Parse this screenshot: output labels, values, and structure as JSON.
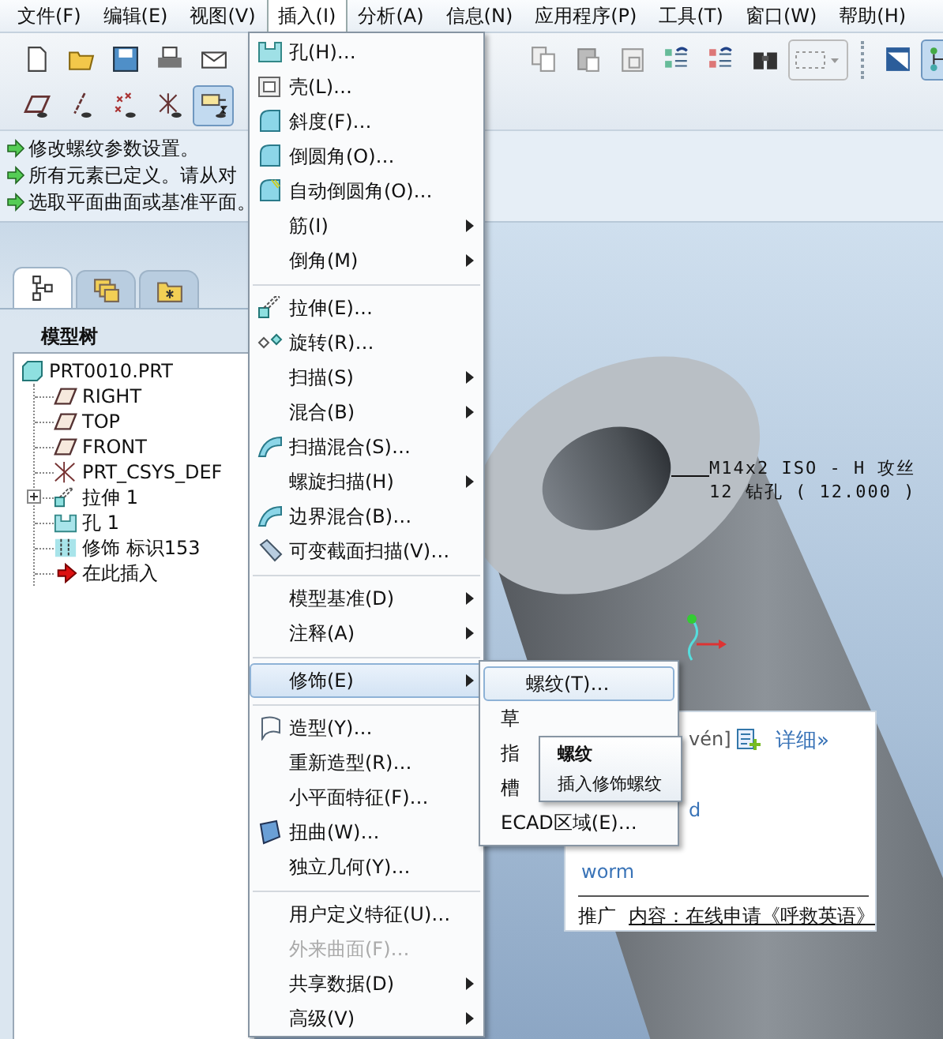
{
  "menubar": [
    {
      "label": "文件(F)",
      "selected": false
    },
    {
      "label": "编辑(E)",
      "selected": false
    },
    {
      "label": "视图(V)",
      "selected": false
    },
    {
      "label": "插入(I)",
      "selected": true
    },
    {
      "label": "分析(A)",
      "selected": false
    },
    {
      "label": "信息(N)",
      "selected": false
    },
    {
      "label": "应用程序(P)",
      "selected": false
    },
    {
      "label": "工具(T)",
      "selected": false
    },
    {
      "label": "窗口(W)",
      "selected": false
    },
    {
      "label": "帮助(H)",
      "selected": false
    }
  ],
  "toolbar": {
    "row_1_left": [
      {
        "kind": "new",
        "pressed": false
      },
      {
        "kind": "open",
        "pressed": false
      },
      {
        "kind": "save",
        "pressed": false
      },
      {
        "kind": "print",
        "pressed": false
      },
      {
        "kind": "mail",
        "pressed": false
      }
    ],
    "row_1_right": [
      {
        "kind": "copy",
        "pressed": false
      },
      {
        "kind": "paste",
        "pressed": false
      },
      {
        "kind": "paste_special",
        "pressed": false
      },
      {
        "kind": "regen",
        "pressed": false
      },
      {
        "kind": "regen_red",
        "pressed": false
      },
      {
        "kind": "find",
        "pressed": false
      },
      {
        "kind": "select_box",
        "pressed": false
      }
    ],
    "row_1_far_right": [
      {
        "kind": "view",
        "pressed": false
      },
      {
        "kind": "tree",
        "pressed": true
      }
    ],
    "row_2": [
      {
        "kind": "plane",
        "pressed": false
      },
      {
        "kind": "axis",
        "pressed": false
      },
      {
        "kind": "point",
        "pressed": false
      },
      {
        "kind": "csys",
        "pressed": false
      },
      {
        "kind": "annotation",
        "pressed": true
      }
    ]
  },
  "messages": [
    "修改螺纹参数设置。",
    "所有元素已定义。请从对",
    "选取平面曲面或基准平面。"
  ],
  "navigator_tabs": [
    {
      "kind": "tree",
      "selected": true
    },
    {
      "kind": "layers",
      "selected": false
    },
    {
      "kind": "folder",
      "selected": false
    }
  ],
  "model_tree": {
    "title": "模型树",
    "root": {
      "label": "PRT0010.PRT",
      "kind": "part",
      "children": [
        {
          "label": "RIGHT",
          "kind": "plane"
        },
        {
          "label": "TOP",
          "kind": "plane"
        },
        {
          "label": "FRONT",
          "kind": "plane"
        },
        {
          "label": "PRT_CSYS_DEF",
          "kind": "csys"
        },
        {
          "label": "拉伸 1",
          "kind": "extrude",
          "expanded": false
        },
        {
          "label": "孔 1",
          "kind": "hole"
        },
        {
          "label": "修饰 标识153",
          "kind": "cosmetic"
        },
        {
          "label": "在此插入",
          "kind": "insert_here"
        }
      ]
    }
  },
  "viewport": {
    "annotation": [
      "M14x2 ISO - H 攻丝",
      "12 钻孔 ( 12.000 )"
    ]
  },
  "insert_menu": {
    "items": [
      {
        "kind": "command",
        "label": "孔(H)…",
        "selected": false,
        "disabled": false
      },
      {
        "kind": "command",
        "label": "壳(L)…",
        "selected": false,
        "disabled": false
      },
      {
        "kind": "command",
        "label": "斜度(F)…",
        "selected": false,
        "disabled": false
      },
      {
        "kind": "command",
        "label": "倒圆角(O)…",
        "selected": false,
        "disabled": false
      },
      {
        "kind": "command",
        "label": "自动倒圆角(O)…",
        "selected": false,
        "disabled": false
      },
      {
        "kind": "submenu",
        "label": "筋(I)",
        "selected": false,
        "disabled": false
      },
      {
        "kind": "submenu",
        "label": "倒角(M)",
        "selected": false,
        "disabled": false
      },
      {
        "kind": "separator"
      },
      {
        "kind": "command",
        "label": "拉伸(E)…",
        "selected": false,
        "disabled": false
      },
      {
        "kind": "command",
        "label": "旋转(R)…",
        "selected": false,
        "disabled": false
      },
      {
        "kind": "submenu",
        "label": "扫描(S)",
        "selected": false,
        "disabled": false
      },
      {
        "kind": "submenu",
        "label": "混合(B)",
        "selected": false,
        "disabled": false
      },
      {
        "kind": "command",
        "label": "扫描混合(S)…",
        "selected": false,
        "disabled": false
      },
      {
        "kind": "submenu",
        "label": "螺旋扫描(H)",
        "selected": false,
        "disabled": false
      },
      {
        "kind": "command",
        "label": "边界混合(B)…",
        "selected": false,
        "disabled": false
      },
      {
        "kind": "command",
        "label": "可变截面扫描(V)…",
        "selected": false,
        "disabled": false
      },
      {
        "kind": "separator"
      },
      {
        "kind": "submenu",
        "label": "模型基准(D)",
        "selected": false,
        "disabled": false
      },
      {
        "kind": "submenu",
        "label": "注释(A)",
        "selected": false,
        "disabled": false
      },
      {
        "kind": "separator"
      },
      {
        "kind": "submenu",
        "label": "修饰(E)",
        "selected": true,
        "disabled": false
      },
      {
        "kind": "separator"
      },
      {
        "kind": "command",
        "label": "造型(Y)…",
        "selected": false,
        "disabled": false
      },
      {
        "kind": "command",
        "label": "重新造型(R)…",
        "selected": false,
        "disabled": false
      },
      {
        "kind": "command",
        "label": "小平面特征(F)…",
        "selected": false,
        "disabled": false
      },
      {
        "kind": "command",
        "label": "扭曲(W)…",
        "selected": false,
        "disabled": false
      },
      {
        "kind": "command",
        "label": "独立几何(Y)…",
        "selected": false,
        "disabled": false
      },
      {
        "kind": "separator"
      },
      {
        "kind": "command",
        "label": "用户定义特征(U)…",
        "selected": false,
        "disabled": false
      },
      {
        "kind": "command",
        "label": "外来曲面(F)…",
        "selected": false,
        "disabled": true
      },
      {
        "kind": "submenu",
        "label": "共享数据(D)",
        "selected": false,
        "disabled": false
      },
      {
        "kind": "submenu",
        "label": "高级(V)",
        "selected": false,
        "disabled": false
      }
    ]
  },
  "cosmetic_submenu": {
    "items": [
      {
        "label": "螺纹(T)…",
        "selected": true
      },
      {
        "label": "草",
        "selected": false
      },
      {
        "label": "指",
        "selected": false
      },
      {
        "label": "槽",
        "selected": false
      },
      {
        "label": "ECAD区域(E)…",
        "selected": false
      }
    ]
  },
  "tooltip": {
    "title": "螺纹",
    "description": "插入修饰螺纹"
  },
  "dictionary_popup": {
    "phonetic_fragment": "vén]",
    "details_link": "详细»",
    "line_fragment": "d",
    "word": "worm",
    "promo_label": "推广",
    "promo_link": "内容：在线申请《呼救英语》"
  }
}
